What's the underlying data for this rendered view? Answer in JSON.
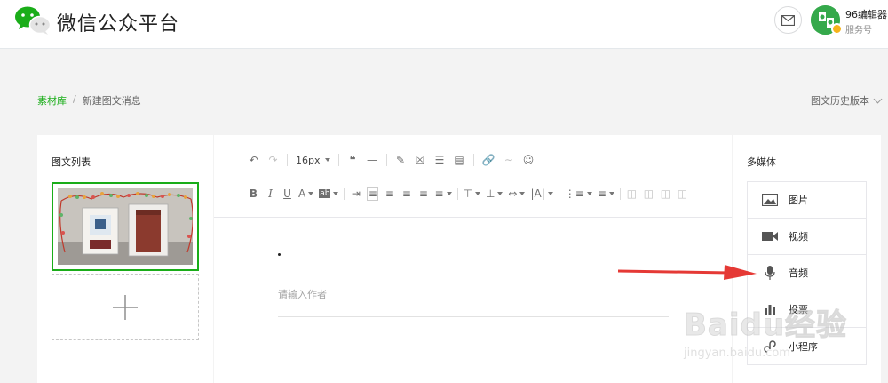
{
  "header": {
    "brand": "微信公众平台",
    "account_name": "96编辑器",
    "account_type": "服务号"
  },
  "breadcrumb": {
    "root": "素材库",
    "separator": "/",
    "current": "新建图文消息",
    "history": "图文历史版本"
  },
  "left_panel": {
    "title": "图文列表"
  },
  "toolbar": {
    "font_size": "16px"
  },
  "editor": {
    "author_placeholder": "请输入作者"
  },
  "right_panel": {
    "title": "多媒体",
    "items": [
      {
        "label": "图片",
        "icon": "image-icon"
      },
      {
        "label": "视频",
        "icon": "video-icon"
      },
      {
        "label": "音频",
        "icon": "microphone-icon"
      },
      {
        "label": "投票",
        "icon": "vote-icon"
      },
      {
        "label": "小程序",
        "icon": "mini-program-icon"
      }
    ]
  },
  "watermark": {
    "brand": "Baidu经验",
    "url": "jingyan.baidu.com"
  },
  "colors": {
    "accent": "#1aad19",
    "arrow": "#e53935"
  }
}
